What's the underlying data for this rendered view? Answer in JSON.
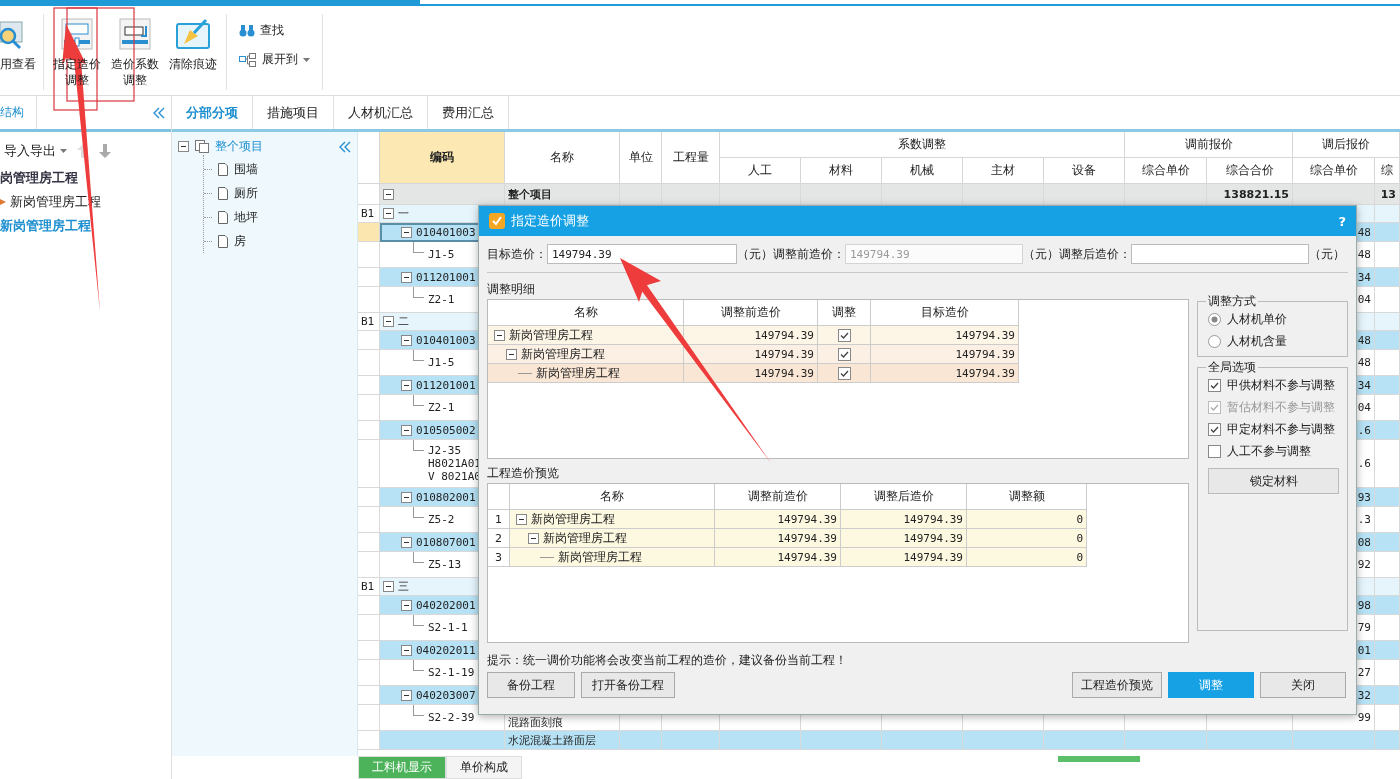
{
  "toolbar": {
    "large_buttons": [
      {
        "lines": [
          "用查看"
        ]
      },
      {
        "lines": [
          "指定造价",
          "调整"
        ]
      },
      {
        "lines": [
          "造价系数",
          "调整"
        ]
      },
      {
        "lines": [
          "清除痕迹"
        ]
      }
    ],
    "small_buttons": [
      {
        "label": "查找",
        "dropdown": false
      },
      {
        "label": "展开到",
        "dropdown": true
      }
    ]
  },
  "left_panel": {
    "tab": "结构",
    "toolbar_label": "导入导出",
    "tree": [
      {
        "label": "岗管理房工程",
        "selected": false,
        "children": [
          {
            "label": "新岗管理房工程",
            "selected": false,
            "children": [
              {
                "label": "新岗管理房工程",
                "selected": true
              }
            ]
          }
        ]
      }
    ]
  },
  "view_tabs": [
    {
      "label": "分部分项",
      "selected": true
    },
    {
      "label": "措施项目",
      "selected": false
    },
    {
      "label": "人材机汇总",
      "selected": false
    },
    {
      "label": "费用汇总",
      "selected": false
    }
  ],
  "section_tree": {
    "label": "整个项目",
    "children": [
      {
        "label": "围墙"
      },
      {
        "label": "厕所"
      },
      {
        "label": "地坪"
      },
      {
        "label": "房"
      }
    ]
  },
  "grid": {
    "single_columns": [
      "编码",
      "名称",
      "单位",
      "工程量"
    ],
    "groups": [
      {
        "label": "系数调整",
        "columns": [
          "人工",
          "材料",
          "机械",
          "主材",
          "设备"
        ]
      },
      {
        "label": "调前报价",
        "columns": [
          "综合单价",
          "综合合价"
        ]
      },
      {
        "label": "调后报价",
        "columns": [
          "综合单价",
          "综"
        ]
      }
    ],
    "total": {
      "name": "整个项目",
      "before_total": "138821.15",
      "after_total": "13"
    },
    "sections": [
      {
        "mark": "B1",
        "name": "一",
        "items": [
          {
            "code": "010401003",
            "value": "48",
            "selected": true,
            "children": [
              {
                "code": "J1-5",
                "value": "48"
              }
            ]
          },
          {
            "code": "011201001",
            "value": "34",
            "selected": false,
            "children": [
              {
                "code": "Z2-1",
                "value": "04"
              }
            ]
          }
        ]
      },
      {
        "mark": "B1",
        "name": "二",
        "items": [
          {
            "code": "010401003",
            "value": "48",
            "selected": false,
            "children": [
              {
                "code": "J1-5",
                "value": "48"
              }
            ]
          },
          {
            "code": "011201001",
            "value": "34",
            "selected": false,
            "children": [
              {
                "code": "Z2-1",
                "value": "04"
              }
            ]
          },
          {
            "code": "010505002",
            "value": ".6",
            "selected": false,
            "children": [
              {
                "code": "J2-35",
                "sub_codes": [
                  "H8021A01",
                  "V 8021A0"
                ],
                "value": ".6"
              }
            ]
          },
          {
            "code": "010802001",
            "value": "93",
            "selected": false,
            "children": [
              {
                "code": "Z5-2",
                "value": ".3"
              }
            ]
          },
          {
            "code": "010807001",
            "value": "08",
            "selected": false,
            "children": [
              {
                "code": "Z5-13",
                "value": "92"
              }
            ]
          }
        ]
      },
      {
        "mark": "B1",
        "name": "三",
        "items": [
          {
            "code": "040202001",
            "value": "98",
            "selected": false,
            "children": [
              {
                "code": "S2-1-1",
                "value": "79"
              }
            ]
          },
          {
            "code": "040202011",
            "value": "01",
            "selected": false,
            "children": [
              {
                "code": "S2-1-19",
                "value": "27"
              }
            ]
          },
          {
            "code": "040203007",
            "value": "32",
            "selected": false,
            "children": [
              {
                "code": "S2-2-39",
                "name": "混路面刻痕",
                "value": "99"
              }
            ]
          },
          {
            "name": "水泥混凝土路面层",
            "selected": false
          }
        ]
      }
    ]
  },
  "dialog": {
    "title": "指定造价调整",
    "help": "?",
    "fields": [
      {
        "label": "目标造价：",
        "value": "149794.39",
        "disabled": false,
        "unit": "（元）"
      },
      {
        "label": "调整前造价：",
        "value": "149794.39",
        "disabled": true,
        "unit": "（元）"
      },
      {
        "label": "调整后造价：",
        "disabled": false,
        "unit": "（元）"
      }
    ],
    "detail": {
      "title": "调整明细",
      "columns": [
        "名称",
        "调整前造价",
        "调整",
        "目标造价"
      ],
      "rows": [
        {
          "name": "新岗管理房工程",
          "before": "149794.39",
          "adjust": true,
          "target": "149794.39",
          "children": [
            {
              "name": "新岗管理房工程",
              "before": "149794.39",
              "adjust": true,
              "target": "149794.39",
              "children": [
                {
                  "name": "新岗管理房工程",
                  "before": "149794.39",
                  "adjust": true,
                  "target": "149794.39"
                }
              ]
            }
          ]
        }
      ]
    },
    "method": {
      "title": "调整方式",
      "options": [
        {
          "label": "人材机单价",
          "selected": true
        },
        {
          "label": "人材机含量",
          "selected": false
        }
      ]
    },
    "options": {
      "title": "全局选项",
      "items": [
        {
          "label": "甲供材料不参与调整",
          "checked": true,
          "disabled": false
        },
        {
          "label": "暂估材料不参与调整",
          "checked": true,
          "disabled": true
        },
        {
          "label": "甲定材料不参与调整",
          "checked": true,
          "disabled": false
        },
        {
          "label": "人工不参与调整",
          "checked": false,
          "disabled": false
        }
      ],
      "button": "锁定材料"
    },
    "preview": {
      "title": "工程造价预览",
      "columns": [
        "名称",
        "调整前造价",
        "调整后造价",
        "调整额"
      ],
      "rows": [
        {
          "num": "1",
          "name": "新岗管理房工程",
          "before": "149794.39",
          "after": "149794.39",
          "diff": "0",
          "children": [
            {
              "num": "2",
              "name": "新岗管理房工程",
              "before": "149794.39",
              "after": "149794.39",
              "diff": "0",
              "children": [
                {
                  "num": "3",
                  "name": "新岗管理房工程",
                  "before": "149794.39",
                  "after": "149794.39",
                  "diff": "0"
                }
              ]
            }
          ]
        }
      ]
    },
    "hint": "提示：统一调价功能将会改变当前工程的造价，建议备份当前工程！",
    "left_buttons": [
      {
        "label": "备份工程",
        "primary": false
      },
      {
        "label": "打开备份工程",
        "primary": false
      }
    ],
    "right_buttons": [
      {
        "label": "工程造价预览",
        "primary": false
      },
      {
        "label": "调整",
        "primary": true
      },
      {
        "label": "关闭",
        "primary": false
      }
    ]
  },
  "bottom_tabs": [
    {
      "label": "工料机显示",
      "selected": true
    },
    {
      "label": "单价构成",
      "selected": false
    }
  ]
}
